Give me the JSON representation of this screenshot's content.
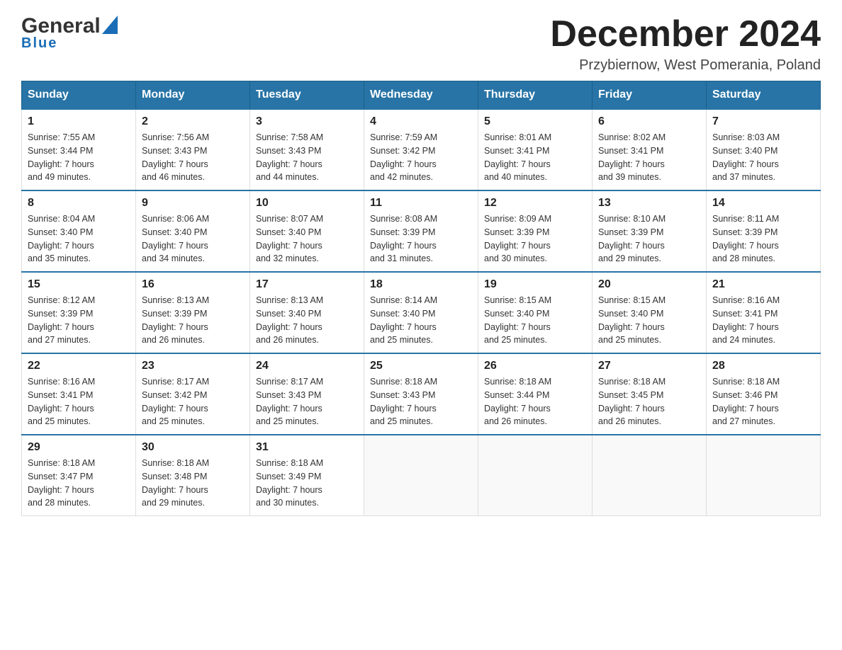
{
  "logo": {
    "name": "General",
    "name2": "Blue"
  },
  "header": {
    "month": "December 2024",
    "location": "Przybiernow, West Pomerania, Poland"
  },
  "weekdays": [
    "Sunday",
    "Monday",
    "Tuesday",
    "Wednesday",
    "Thursday",
    "Friday",
    "Saturday"
  ],
  "weeks": [
    [
      {
        "day": "1",
        "sunrise": "Sunrise: 7:55 AM",
        "sunset": "Sunset: 3:44 PM",
        "daylight": "Daylight: 7 hours",
        "daylight2": "and 49 minutes."
      },
      {
        "day": "2",
        "sunrise": "Sunrise: 7:56 AM",
        "sunset": "Sunset: 3:43 PM",
        "daylight": "Daylight: 7 hours",
        "daylight2": "and 46 minutes."
      },
      {
        "day": "3",
        "sunrise": "Sunrise: 7:58 AM",
        "sunset": "Sunset: 3:43 PM",
        "daylight": "Daylight: 7 hours",
        "daylight2": "and 44 minutes."
      },
      {
        "day": "4",
        "sunrise": "Sunrise: 7:59 AM",
        "sunset": "Sunset: 3:42 PM",
        "daylight": "Daylight: 7 hours",
        "daylight2": "and 42 minutes."
      },
      {
        "day": "5",
        "sunrise": "Sunrise: 8:01 AM",
        "sunset": "Sunset: 3:41 PM",
        "daylight": "Daylight: 7 hours",
        "daylight2": "and 40 minutes."
      },
      {
        "day": "6",
        "sunrise": "Sunrise: 8:02 AM",
        "sunset": "Sunset: 3:41 PM",
        "daylight": "Daylight: 7 hours",
        "daylight2": "and 39 minutes."
      },
      {
        "day": "7",
        "sunrise": "Sunrise: 8:03 AM",
        "sunset": "Sunset: 3:40 PM",
        "daylight": "Daylight: 7 hours",
        "daylight2": "and 37 minutes."
      }
    ],
    [
      {
        "day": "8",
        "sunrise": "Sunrise: 8:04 AM",
        "sunset": "Sunset: 3:40 PM",
        "daylight": "Daylight: 7 hours",
        "daylight2": "and 35 minutes."
      },
      {
        "day": "9",
        "sunrise": "Sunrise: 8:06 AM",
        "sunset": "Sunset: 3:40 PM",
        "daylight": "Daylight: 7 hours",
        "daylight2": "and 34 minutes."
      },
      {
        "day": "10",
        "sunrise": "Sunrise: 8:07 AM",
        "sunset": "Sunset: 3:40 PM",
        "daylight": "Daylight: 7 hours",
        "daylight2": "and 32 minutes."
      },
      {
        "day": "11",
        "sunrise": "Sunrise: 8:08 AM",
        "sunset": "Sunset: 3:39 PM",
        "daylight": "Daylight: 7 hours",
        "daylight2": "and 31 minutes."
      },
      {
        "day": "12",
        "sunrise": "Sunrise: 8:09 AM",
        "sunset": "Sunset: 3:39 PM",
        "daylight": "Daylight: 7 hours",
        "daylight2": "and 30 minutes."
      },
      {
        "day": "13",
        "sunrise": "Sunrise: 8:10 AM",
        "sunset": "Sunset: 3:39 PM",
        "daylight": "Daylight: 7 hours",
        "daylight2": "and 29 minutes."
      },
      {
        "day": "14",
        "sunrise": "Sunrise: 8:11 AM",
        "sunset": "Sunset: 3:39 PM",
        "daylight": "Daylight: 7 hours",
        "daylight2": "and 28 minutes."
      }
    ],
    [
      {
        "day": "15",
        "sunrise": "Sunrise: 8:12 AM",
        "sunset": "Sunset: 3:39 PM",
        "daylight": "Daylight: 7 hours",
        "daylight2": "and 27 minutes."
      },
      {
        "day": "16",
        "sunrise": "Sunrise: 8:13 AM",
        "sunset": "Sunset: 3:39 PM",
        "daylight": "Daylight: 7 hours",
        "daylight2": "and 26 minutes."
      },
      {
        "day": "17",
        "sunrise": "Sunrise: 8:13 AM",
        "sunset": "Sunset: 3:40 PM",
        "daylight": "Daylight: 7 hours",
        "daylight2": "and 26 minutes."
      },
      {
        "day": "18",
        "sunrise": "Sunrise: 8:14 AM",
        "sunset": "Sunset: 3:40 PM",
        "daylight": "Daylight: 7 hours",
        "daylight2": "and 25 minutes."
      },
      {
        "day": "19",
        "sunrise": "Sunrise: 8:15 AM",
        "sunset": "Sunset: 3:40 PM",
        "daylight": "Daylight: 7 hours",
        "daylight2": "and 25 minutes."
      },
      {
        "day": "20",
        "sunrise": "Sunrise: 8:15 AM",
        "sunset": "Sunset: 3:40 PM",
        "daylight": "Daylight: 7 hours",
        "daylight2": "and 25 minutes."
      },
      {
        "day": "21",
        "sunrise": "Sunrise: 8:16 AM",
        "sunset": "Sunset: 3:41 PM",
        "daylight": "Daylight: 7 hours",
        "daylight2": "and 24 minutes."
      }
    ],
    [
      {
        "day": "22",
        "sunrise": "Sunrise: 8:16 AM",
        "sunset": "Sunset: 3:41 PM",
        "daylight": "Daylight: 7 hours",
        "daylight2": "and 25 minutes."
      },
      {
        "day": "23",
        "sunrise": "Sunrise: 8:17 AM",
        "sunset": "Sunset: 3:42 PM",
        "daylight": "Daylight: 7 hours",
        "daylight2": "and 25 minutes."
      },
      {
        "day": "24",
        "sunrise": "Sunrise: 8:17 AM",
        "sunset": "Sunset: 3:43 PM",
        "daylight": "Daylight: 7 hours",
        "daylight2": "and 25 minutes."
      },
      {
        "day": "25",
        "sunrise": "Sunrise: 8:18 AM",
        "sunset": "Sunset: 3:43 PM",
        "daylight": "Daylight: 7 hours",
        "daylight2": "and 25 minutes."
      },
      {
        "day": "26",
        "sunrise": "Sunrise: 8:18 AM",
        "sunset": "Sunset: 3:44 PM",
        "daylight": "Daylight: 7 hours",
        "daylight2": "and 26 minutes."
      },
      {
        "day": "27",
        "sunrise": "Sunrise: 8:18 AM",
        "sunset": "Sunset: 3:45 PM",
        "daylight": "Daylight: 7 hours",
        "daylight2": "and 26 minutes."
      },
      {
        "day": "28",
        "sunrise": "Sunrise: 8:18 AM",
        "sunset": "Sunset: 3:46 PM",
        "daylight": "Daylight: 7 hours",
        "daylight2": "and 27 minutes."
      }
    ],
    [
      {
        "day": "29",
        "sunrise": "Sunrise: 8:18 AM",
        "sunset": "Sunset: 3:47 PM",
        "daylight": "Daylight: 7 hours",
        "daylight2": "and 28 minutes."
      },
      {
        "day": "30",
        "sunrise": "Sunrise: 8:18 AM",
        "sunset": "Sunset: 3:48 PM",
        "daylight": "Daylight: 7 hours",
        "daylight2": "and 29 minutes."
      },
      {
        "day": "31",
        "sunrise": "Sunrise: 8:18 AM",
        "sunset": "Sunset: 3:49 PM",
        "daylight": "Daylight: 7 hours",
        "daylight2": "and 30 minutes."
      },
      null,
      null,
      null,
      null
    ]
  ]
}
